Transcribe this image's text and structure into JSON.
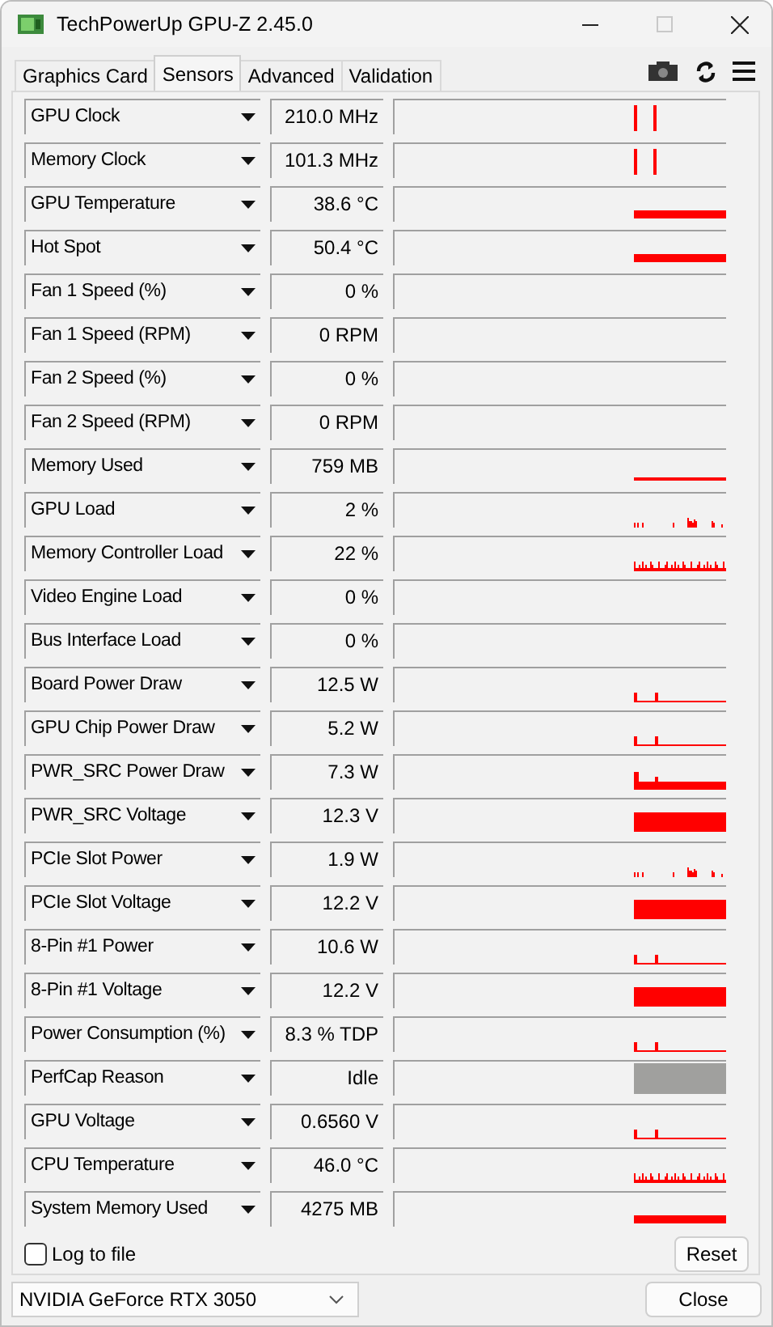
{
  "window": {
    "title": "TechPowerUp GPU-Z 2.45.0"
  },
  "tabs": [
    {
      "label": "Graphics Card",
      "selected": false
    },
    {
      "label": "Sensors",
      "selected": true
    },
    {
      "label": "Advanced",
      "selected": false
    },
    {
      "label": "Validation",
      "selected": false
    }
  ],
  "sensor_rows": [
    {
      "name": "GPU Clock",
      "value": "210.0 MHz",
      "kind": "spikes"
    },
    {
      "name": "Memory Clock",
      "value": "101.3 MHz",
      "kind": "spikes"
    },
    {
      "name": "GPU Temperature",
      "value": "38.6 °C",
      "kind": "band"
    },
    {
      "name": "Hot Spot",
      "value": "50.4 °C",
      "kind": "band"
    },
    {
      "name": "Fan 1 Speed (%)",
      "value": "0 %",
      "kind": "none"
    },
    {
      "name": "Fan 1 Speed (RPM)",
      "value": "0 RPM",
      "kind": "none"
    },
    {
      "name": "Fan 2 Speed (%)",
      "value": "0 %",
      "kind": "none"
    },
    {
      "name": "Fan 2 Speed (RPM)",
      "value": "0 RPM",
      "kind": "none"
    },
    {
      "name": "Memory Used",
      "value": "759 MB",
      "kind": "line"
    },
    {
      "name": "GPU Load",
      "value": "2 %",
      "kind": "sparse"
    },
    {
      "name": "Memory Controller Load",
      "value": "22 %",
      "kind": "noise"
    },
    {
      "name": "Video Engine Load",
      "value": "0 %",
      "kind": "none"
    },
    {
      "name": "Bus Interface Load",
      "value": "0 %",
      "kind": "none"
    },
    {
      "name": "Board Power Draw",
      "value": "12.5 W",
      "kind": "low"
    },
    {
      "name": "GPU Chip Power Draw",
      "value": "5.2 W",
      "kind": "low"
    },
    {
      "name": "PWR_SRC Power Draw",
      "value": "7.3 W",
      "kind": "mid"
    },
    {
      "name": "PWR_SRC Voltage",
      "value": "12.3 V",
      "kind": "block"
    },
    {
      "name": "PCIe Slot Power",
      "value": "1.9 W",
      "kind": "sparse"
    },
    {
      "name": "PCIe Slot Voltage",
      "value": "12.2 V",
      "kind": "block"
    },
    {
      "name": "8-Pin #1 Power",
      "value": "10.6 W",
      "kind": "low"
    },
    {
      "name": "8-Pin #1 Voltage",
      "value": "12.2 V",
      "kind": "block"
    },
    {
      "name": "Power Consumption (%)",
      "value": "8.3 % TDP",
      "kind": "low"
    },
    {
      "name": "PerfCap Reason",
      "value": "Idle",
      "kind": "grey"
    },
    {
      "name": "GPU Voltage",
      "value": "0.6560 V",
      "kind": "low"
    },
    {
      "name": "CPU Temperature",
      "value": "46.0 °C",
      "kind": "noise"
    },
    {
      "name": "System Memory Used",
      "value": "4275 MB",
      "kind": "band"
    }
  ],
  "log_to_file": {
    "label": "Log to file",
    "checked": false
  },
  "reset_button": "Reset",
  "gpu_select": {
    "value": "NVIDIA GeForce RTX 3050"
  },
  "close_button": "Close"
}
